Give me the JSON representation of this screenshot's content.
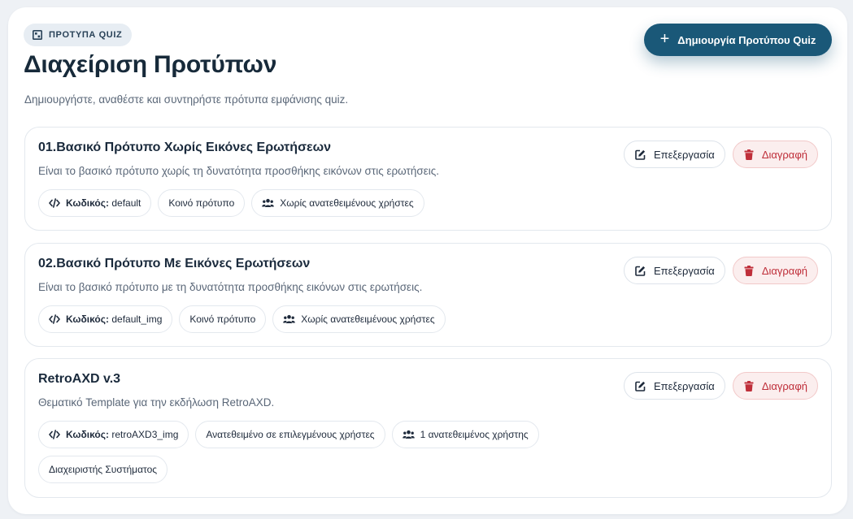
{
  "header": {
    "eyebrow": "ΠΡΟΤΥΠΑ QUIZ",
    "title": "Διαχείριση Προτύπων",
    "subtitle": "Δημιουργήστε, αναθέστε και συντηρήστε πρότυπα εμφάνισης quiz.",
    "create_button": "Δημιουργία Προτύπου Quiz"
  },
  "actions": {
    "edit_label": "Επεξεργασία",
    "delete_label": "Διαγραφή"
  },
  "templates": [
    {
      "name": "01.Βασικό Πρότυπο Χωρίς Εικόνες Ερωτήσεων",
      "description": "Είναι το βασικό πρότυπο χωρίς τη δυνατότητα προσθήκης εικόνων στις ερωτήσεις.",
      "code_label": "Κωδικός:",
      "code_value": "default",
      "visibility": "Κοινό πρότυπο",
      "assignees": "Χωρίς ανατεθειμένους χρήστες"
    },
    {
      "name": "02.Βασικό Πρότυπο Με Εικόνες Ερωτήσεων",
      "description": "Είναι το βασικό πρότυπο με τη δυνατότητα προσθήκης εικόνων στις ερωτήσεις.",
      "code_label": "Κωδικός:",
      "code_value": "default_img",
      "visibility": "Κοινό πρότυπο",
      "assignees": "Χωρίς ανατεθειμένους χρήστες"
    },
    {
      "name": "RetroAXD v.3",
      "description": "Θεματικό Template για την εκδήλωση RetroAXD.",
      "code_label": "Κωδικός:",
      "code_value": "retroAXD3_img",
      "visibility": "Ανατεθειμένο σε επιλεγμένους χρήστες",
      "assignees": "1 ανατεθειμένος χρήστης",
      "assigned_users": [
        "Διαχειριστής Συστήματος"
      ]
    }
  ],
  "icons": {
    "eyebrow": "template-icon",
    "create": "plus-icon",
    "edit": "edit-icon",
    "delete": "trash-icon",
    "code": "code-icon",
    "users": "users-icon"
  },
  "colors": {
    "primary": "#1a5878",
    "danger": "#bf2f3a",
    "danger_bg": "#fbeeee",
    "page_bg": "#eef1f5"
  }
}
